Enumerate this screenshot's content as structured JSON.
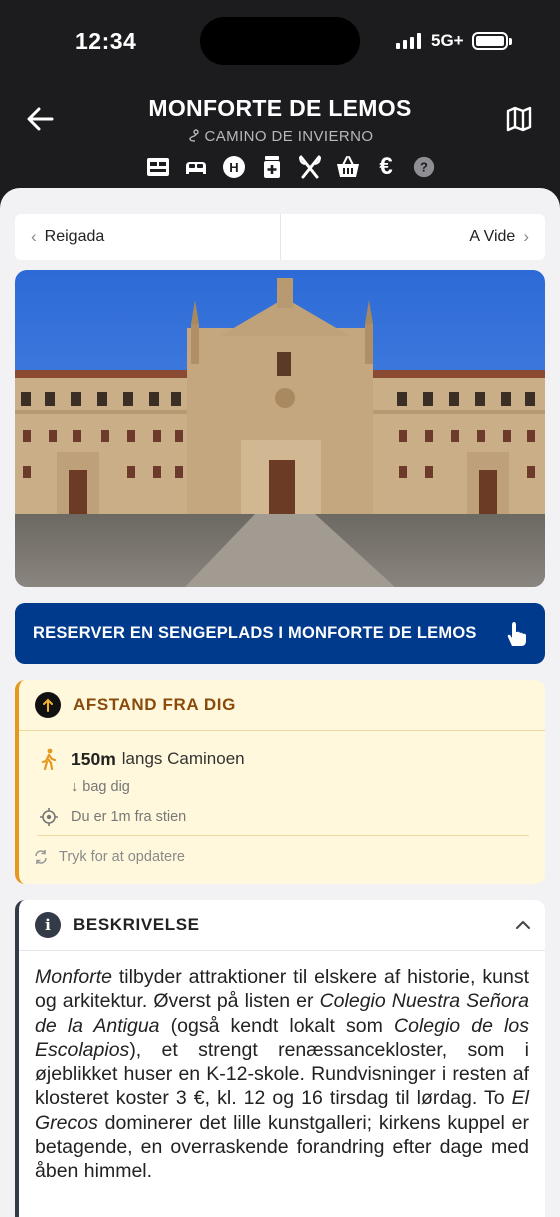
{
  "status": {
    "time": "12:34",
    "network": "5G+"
  },
  "header": {
    "title": "MONFORTE DE LEMOS",
    "subtitle": "CAMINO DE INVIERNO",
    "amenities": [
      "albergue-icon",
      "bed-icon",
      "hotel-icon",
      "pharmacy-icon",
      "restaurant-icon",
      "shop-basket-icon",
      "euro-icon",
      "help-icon"
    ],
    "amenity_labels": {
      "hotel": "H",
      "euro": "€",
      "help": "?"
    }
  },
  "nav": {
    "prev": "Reigada",
    "next": "A Vide"
  },
  "reserve": {
    "label": "RESERVER EN SENGEPLADS I MONFORTE DE LEMOS"
  },
  "distance": {
    "title": "AFSTAND FRA DIG",
    "value": "150m",
    "along": "langs Caminoen",
    "direction": "↓ bag dig",
    "offtrail": "Du er 1m fra stien",
    "refresh": "Tryk for at opdatere"
  },
  "description": {
    "title": "BESKRIVELSE",
    "p1": "Monforte",
    "p2": " tilbyder attraktioner til elskere af historie, kunst og arkitektur. Øverst på listen er ",
    "p3": "Colegio Nuestra Señora de la Antigua",
    "p4": " (også kendt lokalt som ",
    "p5": "Colegio de los Escolapios",
    "p6": "), et strengt renæssancekloster, som i øjeblikket huser en K-12-skole. Rundvisninger i resten af klosteret koster 3 €, kl. 12 og 16 tirsdag til lørdag. To ",
    "p7": "El Grecos",
    "p8": " dominerer det lille kunstgalleri; kirkens kuppel er betagende, en overraskende forandring efter dage med åben himmel."
  },
  "colors": {
    "accent_blue": "#003a8c",
    "warning_bg": "#fff8dc",
    "warning_border": "#e5981f",
    "warning_text": "#8a4a0b"
  }
}
